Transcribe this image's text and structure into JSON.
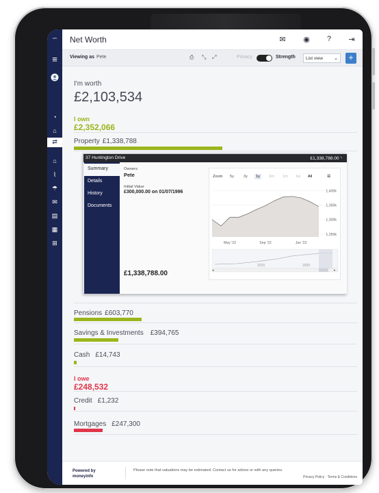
{
  "page": {
    "title": "Net Worth"
  },
  "toolbar": {
    "viewing_as": "Viewing as",
    "user": "Pete",
    "privacy": "Privacy",
    "strength": "Strength",
    "view_select": "List view",
    "add": "+"
  },
  "summary": {
    "worth_label": "I'm worth",
    "worth_amount": "£2,103,534",
    "own_label": "I own",
    "own_amount": "£2,352,066",
    "owe_label": "I owe",
    "owe_amount": "£248,532"
  },
  "assets": [
    {
      "label": "Property",
      "value": "£1,338,788",
      "progress": 0.57,
      "color": "#9ab51c"
    },
    {
      "label": "Pensions",
      "value": "£603,770",
      "progress": 0.26,
      "color": "#9ab51c"
    },
    {
      "label": "Savings & Investments",
      "value": "£394,765",
      "progress": 0.17,
      "color": "#9ab51c"
    },
    {
      "label": "Cash",
      "value": "£14,743",
      "progress": 0.01,
      "color": "#9ab51c"
    }
  ],
  "liabilities": [
    {
      "label": "Credit",
      "value": "£1,232",
      "progress": 0.005,
      "color": "#e0364a"
    },
    {
      "label": "Mortgages",
      "value": "£247,300",
      "progress": 0.11,
      "color": "#e0364a"
    }
  ],
  "popup": {
    "title": "37 Huntington Drive",
    "value": "£1,338,788.00",
    "nav": [
      "Summary",
      "Details",
      "History",
      "Documents"
    ],
    "owners_label": "Owners",
    "owners": "Pete",
    "initial_label": "Initial Value",
    "initial": "£300,000.00 on 01/07/1996",
    "current": "£1,338,788.00",
    "chart": {
      "zoom_label": "Zoom",
      "zoom_options": [
        "5y",
        "3y",
        "1y",
        "3m",
        "1m",
        "1w",
        "All"
      ],
      "y_ticks": [
        "1,400k",
        "1,350k",
        "1,300k",
        "1,250k"
      ],
      "x_ticks": [
        "May '22",
        "Sep '22",
        "Jan '23"
      ],
      "nav_labels": [
        "2015",
        "2020"
      ]
    }
  },
  "chart_data": {
    "type": "area",
    "x": [
      "Mar '22",
      "Apr '22",
      "May '22",
      "Jun '22",
      "Jul '22",
      "Aug '22",
      "Sep '22",
      "Oct '22",
      "Nov '22",
      "Dec '22",
      "Jan '23",
      "Feb '23",
      "Mar '23"
    ],
    "values": [
      1300,
      1278,
      1308,
      1308,
      1320,
      1335,
      1348,
      1365,
      1378,
      1380,
      1375,
      1362,
      1345
    ],
    "ylim": [
      1240,
      1420
    ],
    "y_ticks": [
      1250,
      1300,
      1350,
      1400
    ]
  },
  "footer": {
    "powered": "Powered by moneyinfo",
    "note": "Please note that valuations may be estimated. Contact us for advice or with any queries.",
    "links": "Privacy Policy · Terms & Conditions"
  }
}
